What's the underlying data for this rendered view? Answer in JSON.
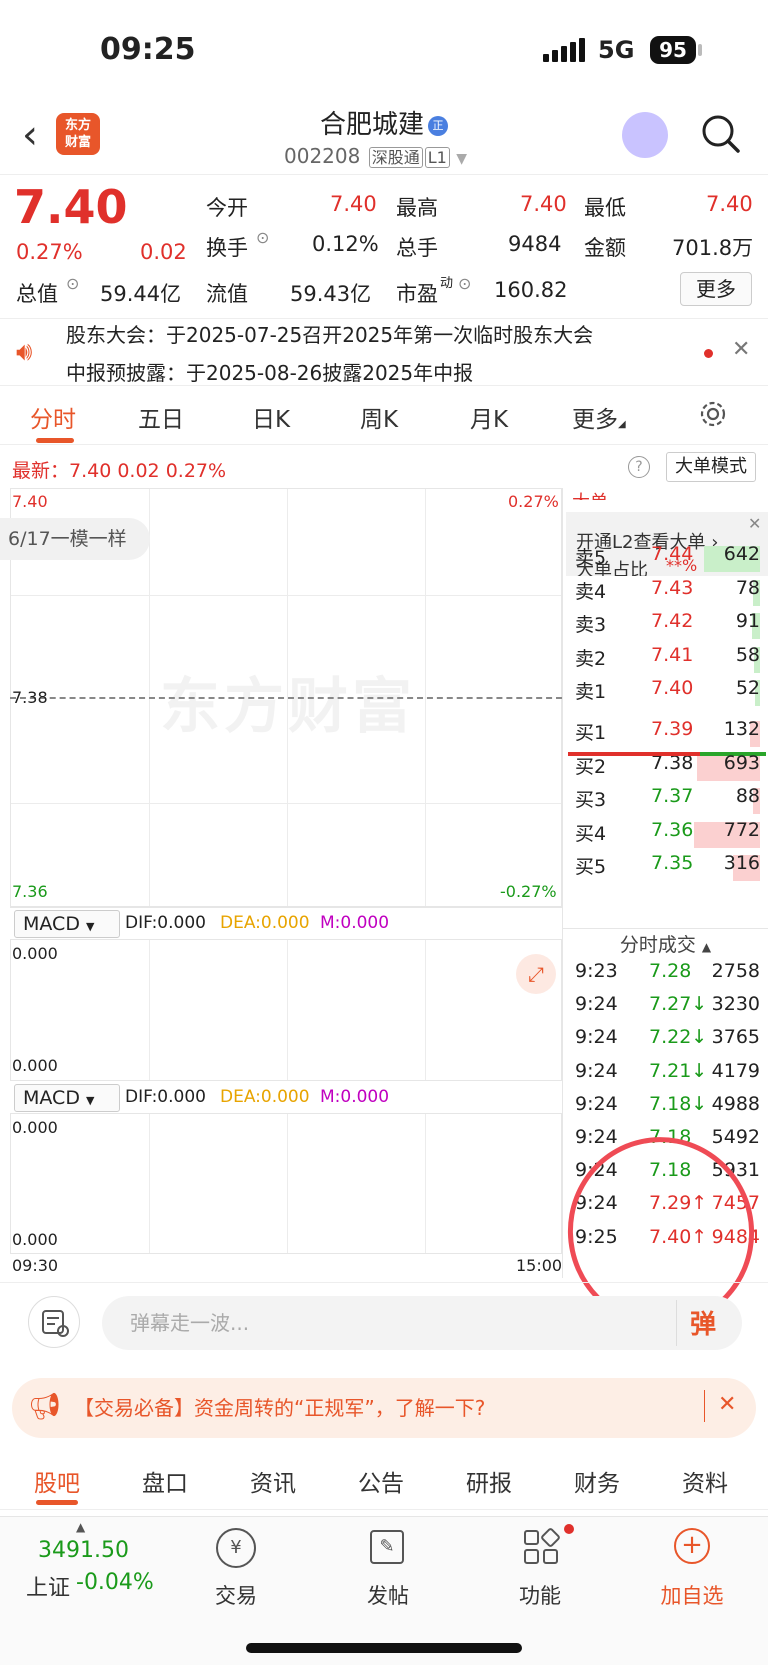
{
  "status": {
    "time": "09:25",
    "network": "5G",
    "battery": "95"
  },
  "stock": {
    "name": "合肥城建",
    "badge": "正",
    "code": "002208",
    "tag1": "深股通",
    "tag2": "L1"
  },
  "quote": {
    "price": "7.40",
    "pct": "0.27%",
    "chg": "0.02",
    "open_label": "今开",
    "open": "7.40",
    "high_label": "最高",
    "high": "7.40",
    "low_label": "最低",
    "low": "7.40",
    "turnover_label": "换手",
    "turnover": "0.12%",
    "volume_label": "总手",
    "volume": "9484",
    "amount_label": "金额",
    "amount": "701.8万",
    "mcap_label": "总值",
    "mcap": "59.44亿",
    "float_label": "流值",
    "float": "59.43亿",
    "pe_label": "市盈",
    "pe_sup": "动",
    "pe": "160.82",
    "more": "更多"
  },
  "notice": {
    "line1": "股东大会：于2025-07-25召开2025年第一次临时股东大会",
    "line2": "中报预披露：于2025-08-26披露2025年中报"
  },
  "tabs": [
    "分时",
    "五日",
    "日K",
    "周K",
    "月K",
    "更多"
  ],
  "latest": "最新：7.40  0.02  0.27%",
  "dadan_mode": "大单模式",
  "chart": {
    "y_top": "7.40",
    "pct_top": "0.27%",
    "y_mid": "7.38",
    "y_bot": "7.36",
    "pct_bot": "-0.27%",
    "pill": "6/17一模一样",
    "watermark": "东方财富",
    "time_start": "09:30",
    "time_end": "15:00"
  },
  "macd": {
    "label": "MACD",
    "dif": "DIF:0.000",
    "dea": "DEA:0.000",
    "m": "M:0.000",
    "y_top": "0.000",
    "y_bot": "0.000"
  },
  "level2": {
    "header": "开通L2查看大单 ›",
    "sub": "大单占比",
    "sub_v1": "**%",
    "sub_v2": "**%",
    "top_cut": "大单"
  },
  "asks": [
    {
      "label": "卖5",
      "price": "7.44",
      "vol": "642",
      "bar": 0.8
    },
    {
      "label": "卖4",
      "price": "7.43",
      "vol": "78",
      "bar": 0.1
    },
    {
      "label": "卖3",
      "price": "7.42",
      "vol": "91",
      "bar": 0.12
    },
    {
      "label": "卖2",
      "price": "7.41",
      "vol": "58",
      "bar": 0.08
    },
    {
      "label": "卖1",
      "price": "7.40",
      "vol": "52",
      "bar": 0.07
    }
  ],
  "bids": [
    {
      "label": "买1",
      "price": "7.39",
      "vol": "132",
      "bar": 0.15
    },
    {
      "label": "买2",
      "price": "7.38",
      "vol": "693",
      "bar": 0.9
    },
    {
      "label": "买3",
      "price": "7.37",
      "vol": "88",
      "bar": 0.1
    },
    {
      "label": "买4",
      "price": "7.36",
      "vol": "772",
      "bar": 0.95
    },
    {
      "label": "买5",
      "price": "7.35",
      "vol": "316",
      "bar": 0.38
    }
  ],
  "trade_title": "分时成交",
  "trades": [
    {
      "t": "9:23",
      "p": "7.28",
      "v": "2758",
      "c": "green"
    },
    {
      "t": "9:24",
      "p": "7.27↓",
      "v": "3230",
      "c": "green"
    },
    {
      "t": "9:24",
      "p": "7.22↓",
      "v": "3765",
      "c": "green"
    },
    {
      "t": "9:24",
      "p": "7.21↓",
      "v": "4179",
      "c": "green"
    },
    {
      "t": "9:24",
      "p": "7.18↓",
      "v": "4988",
      "c": "green"
    },
    {
      "t": "9:24",
      "p": "7.18",
      "v": "5492",
      "c": "green"
    },
    {
      "t": "9:24",
      "p": "7.18",
      "v": "5931",
      "c": "green"
    },
    {
      "t": "9:24",
      "p": "7.29↑",
      "v": "7457",
      "c": "red"
    },
    {
      "t": "9:25",
      "p": "7.40↑",
      "v": "9484",
      "c": "red"
    }
  ],
  "input_placeholder": "弹幕走一波...",
  "promo": "【交易必备】资金周转的“正规军”，了解一下?",
  "bottom_tabs": [
    "股吧",
    "盘口",
    "资讯",
    "公告",
    "研报",
    "财务",
    "资料"
  ],
  "nav": {
    "index_value": "3491.50",
    "index_name": "上证",
    "index_pct": "-0.04%",
    "trade": "交易",
    "post": "发帖",
    "func": "功能",
    "add": "加自选"
  }
}
